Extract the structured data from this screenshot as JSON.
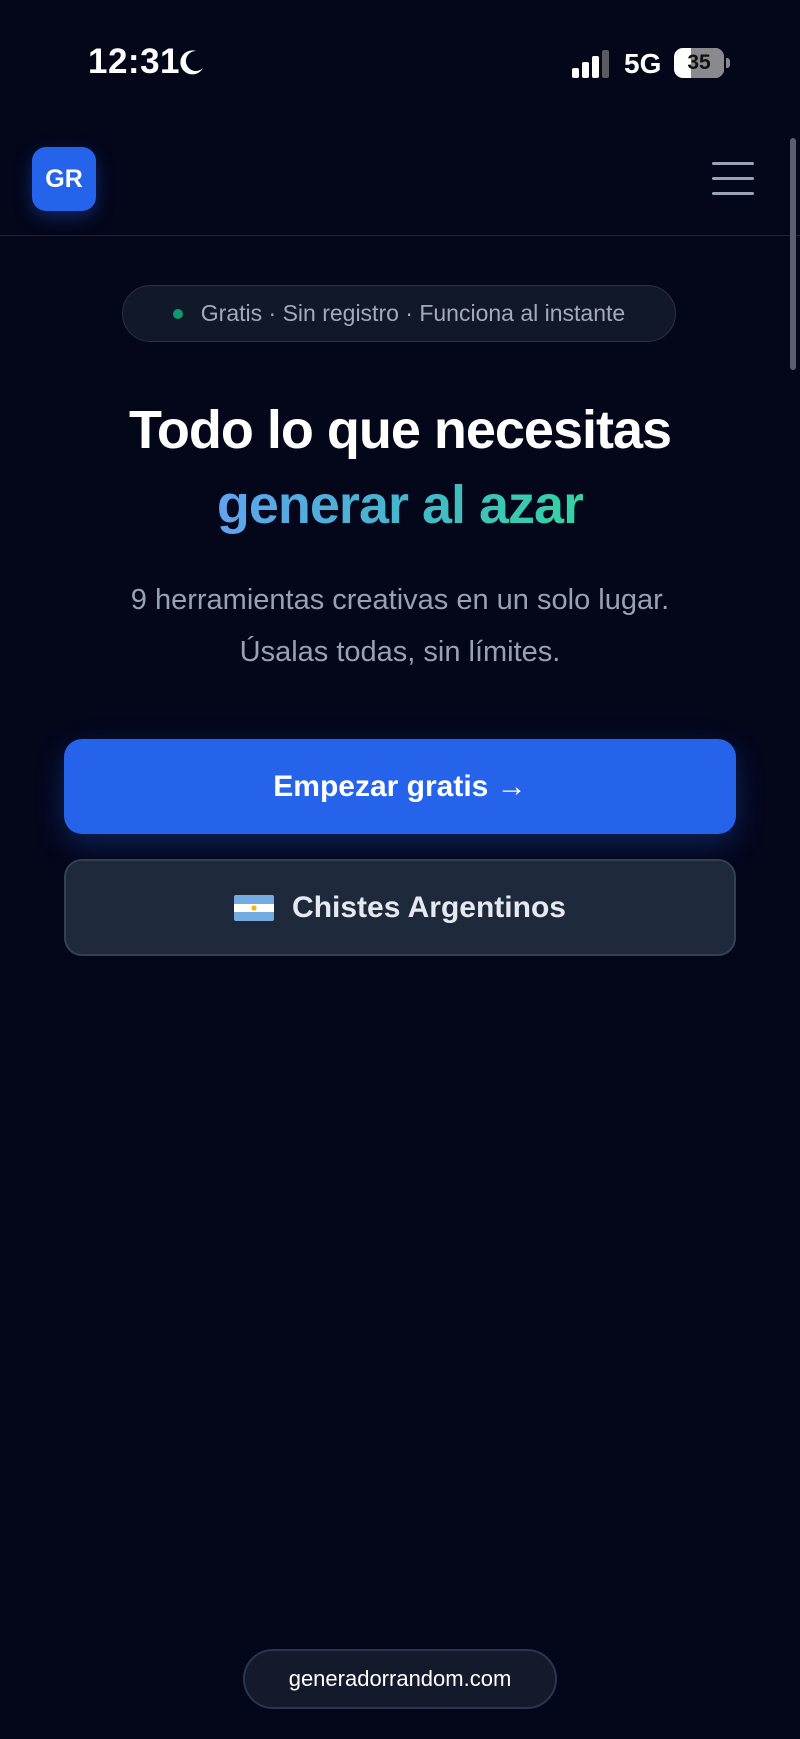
{
  "status_bar": {
    "time": "12:31",
    "network": "5G",
    "battery_level": "35",
    "battery_fraction": 0.35,
    "icons": [
      "moon-icon",
      "signal-icon",
      "battery-icon"
    ]
  },
  "header": {
    "logo_text": "GR",
    "menu_icon": "hamburger-menu-icon"
  },
  "hero": {
    "badge_text": "Gratis · Sin registro · Funciona al instante",
    "title_line1": "Todo lo que necesitas",
    "title_line2": "generar al azar",
    "subtitle_line1": "9 herramientas creativas en un solo lugar.",
    "subtitle_line2": "Úsalas todas, sin límites."
  },
  "actions": {
    "primary_label": "Empezar gratis →",
    "secondary_label": "Chistes Argentinos",
    "secondary_icon": "argentina-flag-icon"
  },
  "footer": {
    "url": "generadorrandom.com"
  },
  "colors": {
    "background": "#04061a",
    "primary": "#2563eb",
    "accent_gradient_start": "#5fa3f0",
    "accent_gradient_end": "#34d3a0",
    "badge_dot": "#10b981"
  }
}
